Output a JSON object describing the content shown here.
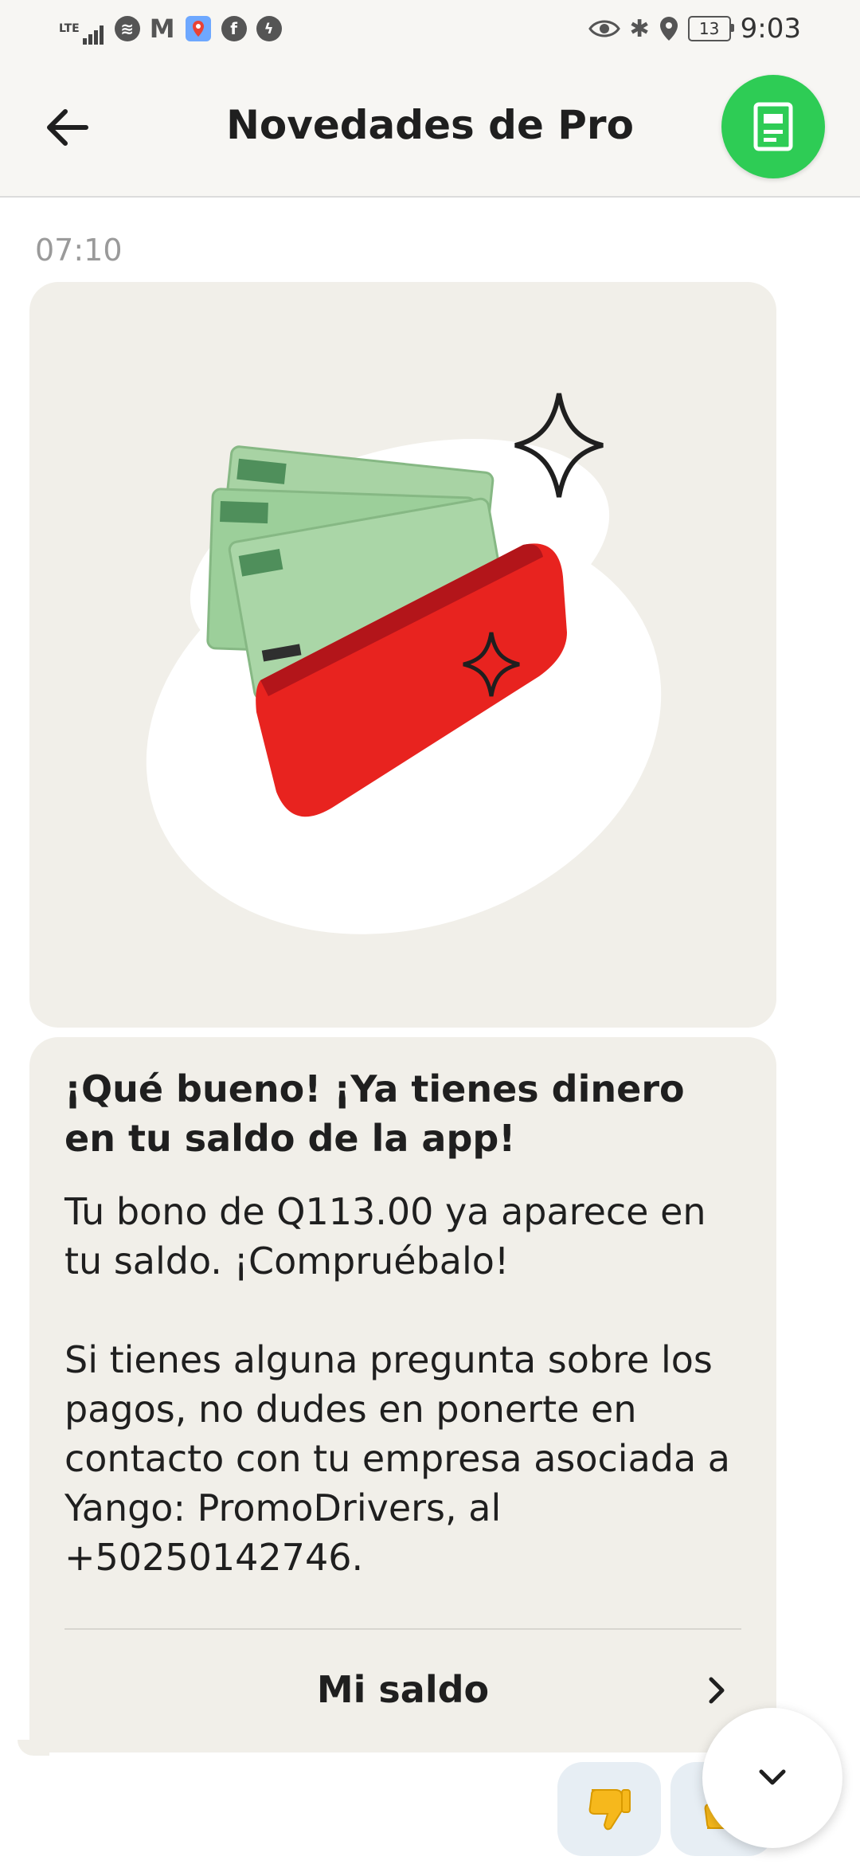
{
  "status_bar": {
    "network": "LTE",
    "time": "9:03",
    "battery": "13"
  },
  "header": {
    "title": "Novedades de Pro"
  },
  "message": {
    "time": "07:10",
    "title": "¡Qué bueno! ¡Ya tienes dinero en tu saldo de la app!",
    "body_1": "Tu bono de Q113.00 ya aparece en tu saldo. ¡Compruébalo!",
    "body_2": "Si tienes alguna pregunta sobre los pagos, no dudes en ponerte en contacto con tu empresa asociada a Yango: PromoDrivers, al +50250142746.",
    "action_label": "Mi saldo"
  },
  "colors": {
    "accent_green": "#2ecc55",
    "card_bg": "#f1efe9",
    "wallet_red": "#e8231f",
    "banknote_green": "#9ccf9a"
  },
  "icons": [
    "back-arrow-icon",
    "document-icon",
    "chevron-right-icon",
    "thumbs-down-icon",
    "thumbs-up-icon",
    "chevron-down-icon"
  ]
}
